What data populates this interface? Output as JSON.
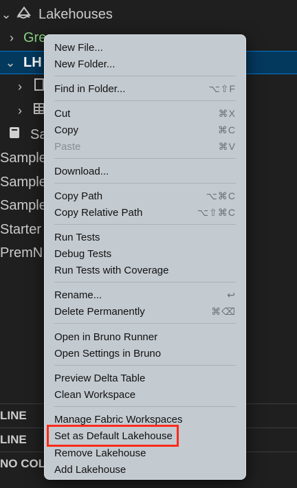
{
  "tree": {
    "root_label": "Lakehouses",
    "item1_label": "Gre",
    "item1_suffix": "",
    "item2_label": "LH",
    "item3_label": "Sa",
    "samples": [
      "Sample",
      "Sample",
      "Sample"
    ],
    "starter": "Starter",
    "premn": "PremN"
  },
  "sections": [
    "LINE",
    "LINE",
    "NO COL"
  ],
  "menu": {
    "items": [
      {
        "label": "New File...",
        "shortcut": ""
      },
      {
        "label": "New Folder...",
        "shortcut": ""
      },
      {
        "label": "Find in Folder...",
        "shortcut": "⌥⇧F"
      },
      {
        "label": "Cut",
        "shortcut": "⌘X"
      },
      {
        "label": "Copy",
        "shortcut": "⌘C"
      },
      {
        "label": "Paste",
        "shortcut": "⌘V",
        "disabled": true
      },
      {
        "label": "Download...",
        "shortcut": ""
      },
      {
        "label": "Copy Path",
        "shortcut": "⌥⌘C"
      },
      {
        "label": "Copy Relative Path",
        "shortcut": "⌥⇧⌘C"
      },
      {
        "label": "Run Tests",
        "shortcut": ""
      },
      {
        "label": "Debug Tests",
        "shortcut": ""
      },
      {
        "label": "Run Tests with Coverage",
        "shortcut": ""
      },
      {
        "label": "Rename...",
        "shortcut": "↩"
      },
      {
        "label": "Delete Permanently",
        "shortcut": "⌘⌫"
      },
      {
        "label": "Open in Bruno Runner",
        "shortcut": ""
      },
      {
        "label": "Open Settings in Bruno",
        "shortcut": ""
      },
      {
        "label": "Preview Delta Table",
        "shortcut": ""
      },
      {
        "label": "Clean Workspace",
        "shortcut": ""
      },
      {
        "label": "Manage Fabric Workspaces",
        "shortcut": ""
      },
      {
        "label": "Set as Default Lakehouse",
        "shortcut": ""
      },
      {
        "label": "Remove Lakehouse",
        "shortcut": ""
      },
      {
        "label": "Add Lakehouse",
        "shortcut": ""
      }
    ]
  },
  "colors": {
    "highlight": "#ff2a1a",
    "selection": "#04395e",
    "green_text": "#89d185"
  }
}
